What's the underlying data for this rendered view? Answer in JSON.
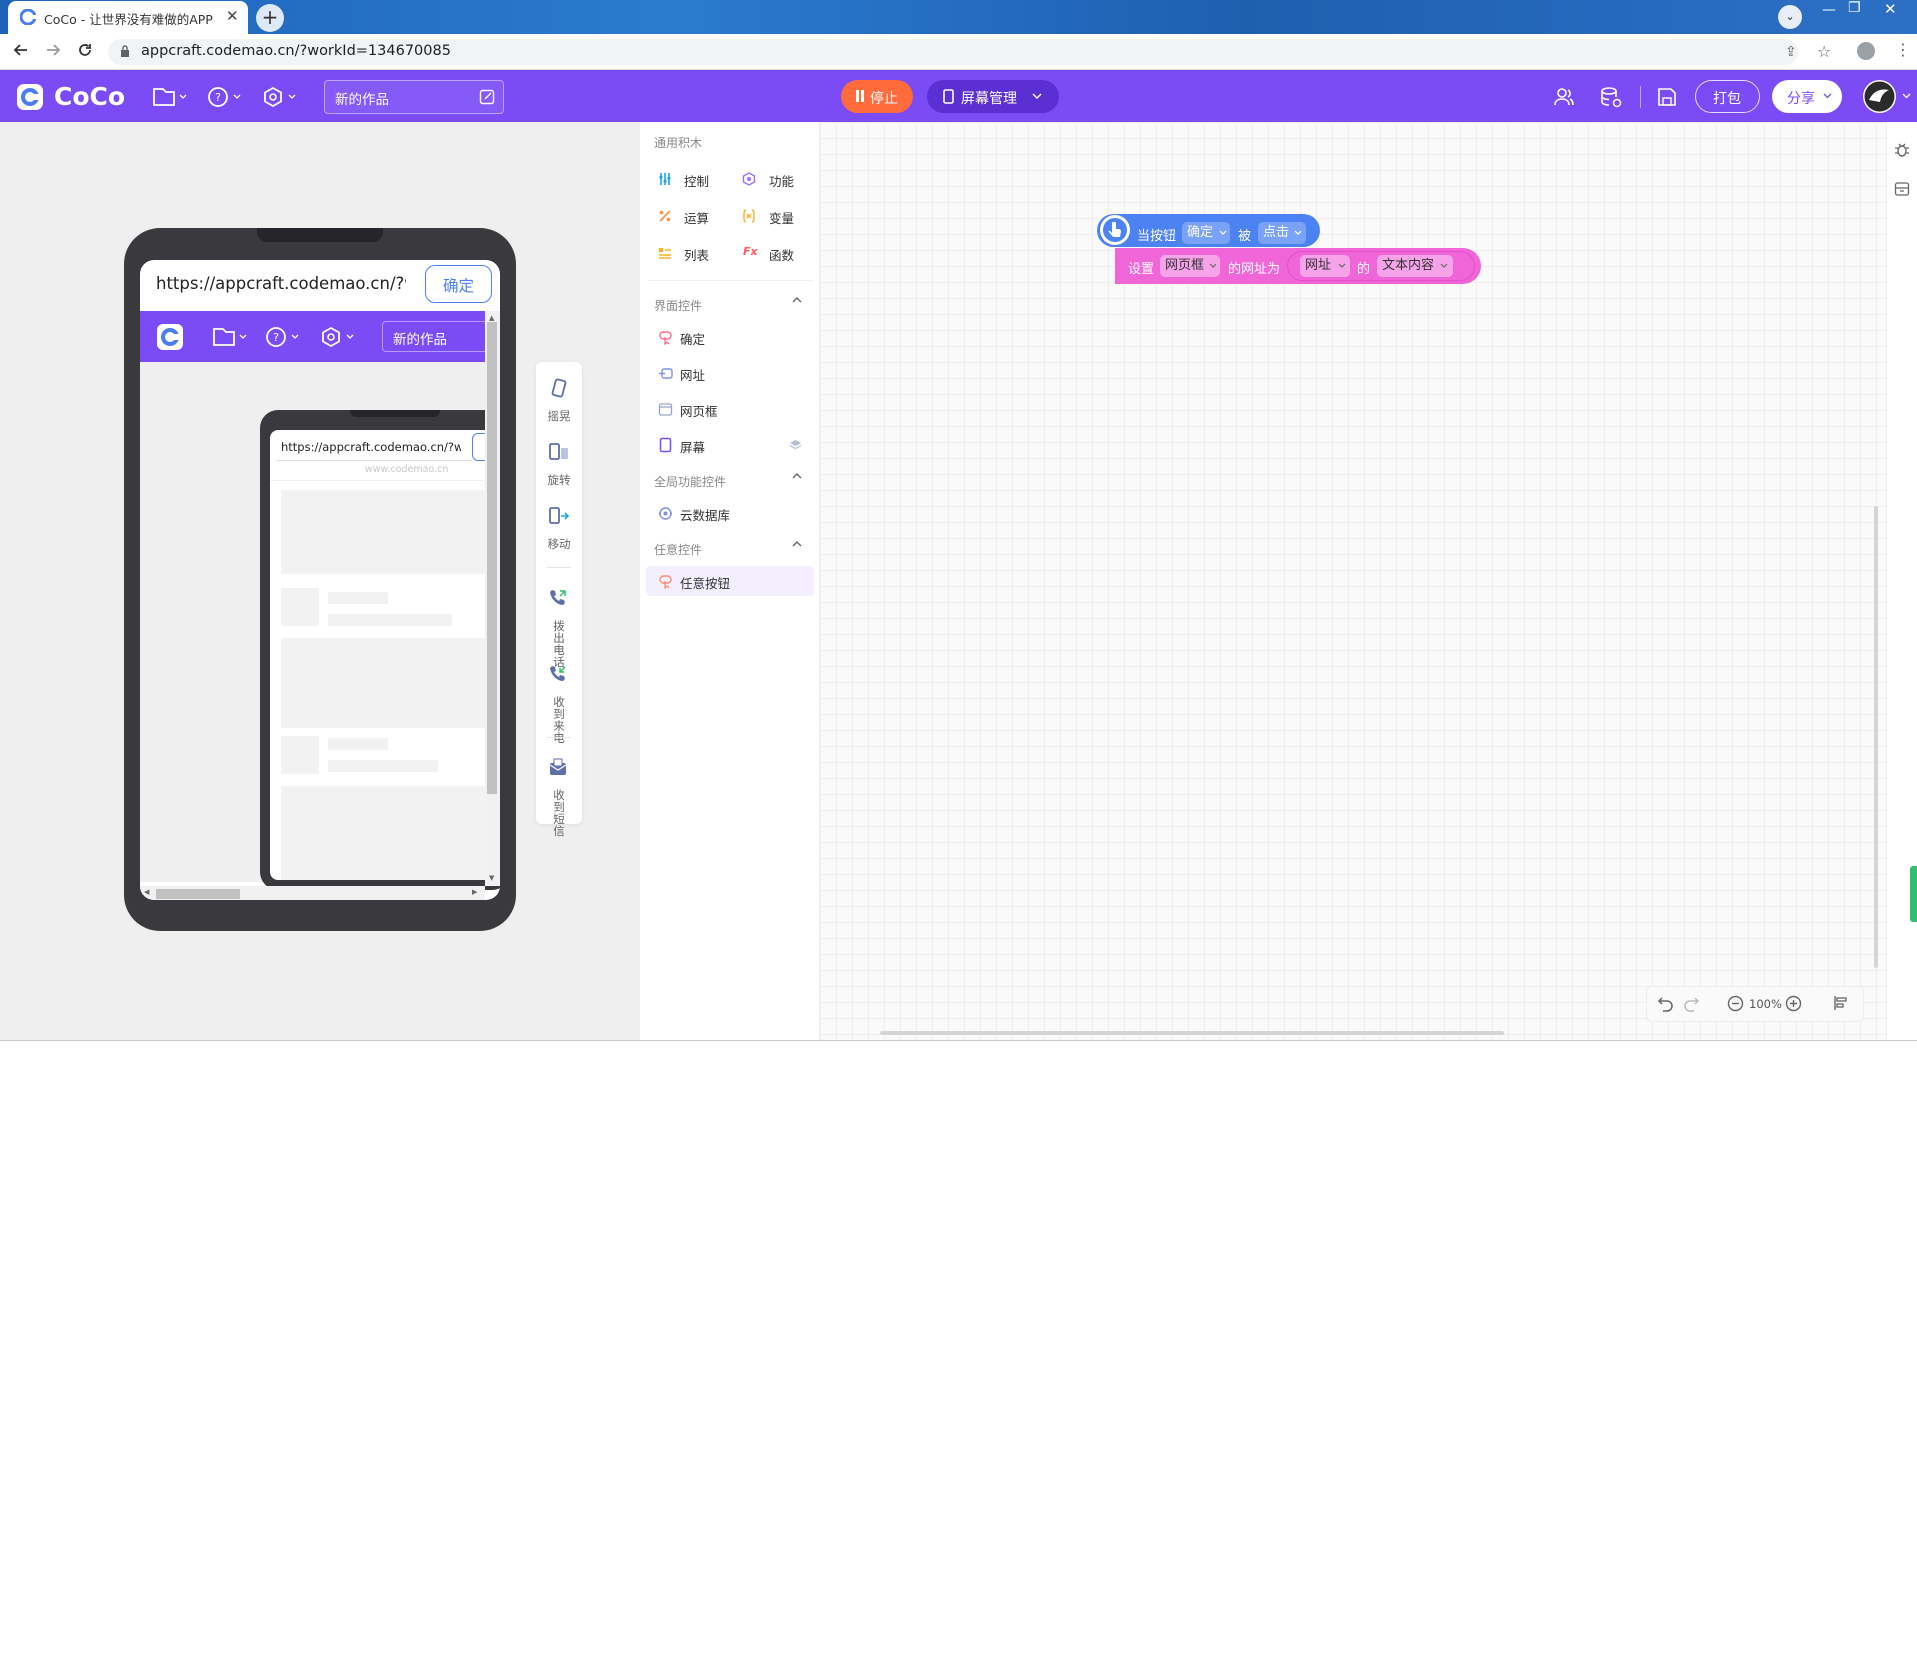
{
  "browser": {
    "tab_title": "CoCo - 让世界没有难做的APP",
    "url": "appcraft.codemao.cn/?workId=134670085"
  },
  "app": {
    "logo_text": "CoCo",
    "work_title": "新的作品",
    "stop_label": "停止",
    "screen_manage_label": "屏幕管理",
    "pack_label": "打包",
    "share_label": "分享",
    "brand_color": "#7b4cf6"
  },
  "preview": {
    "url_field": "https://appcraft.codemao.cn/?wc",
    "confirm_label": "确定",
    "inner_title": "新的作品",
    "nested_url": "https://appcraft.codemao.cn/?wc",
    "nested_watermark": "www.codemao.cn"
  },
  "sensors": [
    "摇晃",
    "旋转",
    "移动",
    "拨出电话",
    "收到来电",
    "收到短信"
  ],
  "palette": {
    "general_header": "通用积木",
    "general": [
      {
        "label": "控制",
        "icon": "control-icon",
        "color": "#1fa3e8"
      },
      {
        "label": "功能",
        "icon": "function-icon",
        "color": "#9b6df7"
      },
      {
        "label": "运算",
        "icon": "operator-icon",
        "color": "#ff8f3f"
      },
      {
        "label": "变量",
        "icon": "variable-icon",
        "color": "#ffb020"
      },
      {
        "label": "列表",
        "icon": "list-icon",
        "color": "#ffb020"
      },
      {
        "label": "函数",
        "icon": "fx-icon",
        "color": "#ff5c5c"
      }
    ],
    "ui_header": "界面控件",
    "ui": [
      "确定",
      "网址",
      "网页框",
      "屏幕"
    ],
    "global_header": "全局功能控件",
    "global": [
      "云数据库"
    ],
    "any_header": "任意控件",
    "any": [
      "任意按钮"
    ]
  },
  "blocks": {
    "event": {
      "prefix": "当按钮",
      "target": "确定",
      "mid": "被",
      "action": "点击",
      "color": "#4d82f3"
    },
    "set": {
      "prefix": "设置",
      "target": "网页框",
      "mid": "的网址为",
      "src": "网址",
      "of": "的",
      "prop": "文本内容",
      "color": "#f066d9"
    }
  },
  "zoom_label": "100%"
}
